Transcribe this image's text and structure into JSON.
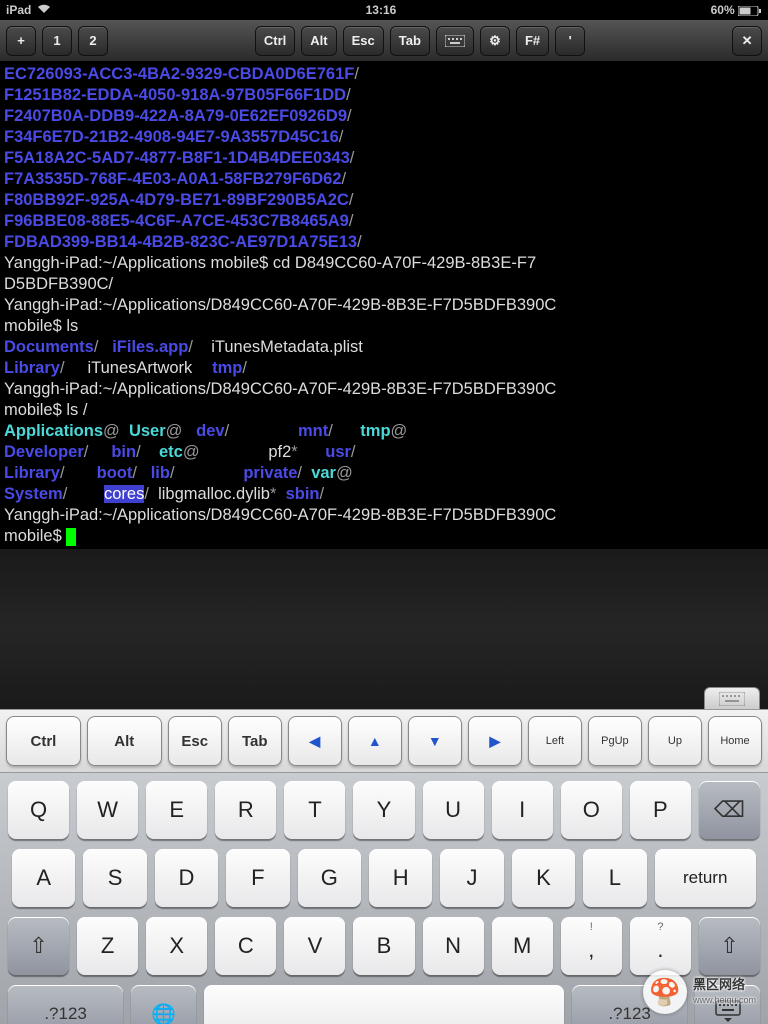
{
  "status": {
    "device": "iPad",
    "time": "13:16",
    "battery": "60%"
  },
  "toolbar": {
    "plus": "+",
    "one": "1",
    "two": "2",
    "ctrl": "Ctrl",
    "alt": "Alt",
    "esc": "Esc",
    "tab": "Tab",
    "fsharp": "F#",
    "apostrophe": "'",
    "close": "✕"
  },
  "terminal": {
    "uuids": [
      "EC726093-ACC3-4BA2-9329-CBDA0D6E761F",
      "F1251B82-EDDA-4050-918A-97B05F66F1DD",
      "F2407B0A-DDB9-422A-8A79-0E62EF0926D9",
      "F34F6E7D-21B2-4908-94E7-9A3557D45C16",
      "F5A18A2C-5AD7-4877-B8F1-1D4B4DEE0343",
      "F7A3535D-768F-4E03-A0A1-58FB279F6D62",
      "F80BB92F-925A-4D79-BE71-89BF290B5A2C",
      "F96BBE08-88E5-4C6F-A7CE-453C7B8465A9",
      "FDBAD399-BB14-4B2B-823C-AE97D1A75E13"
    ],
    "prompt1a": "Yanggh-iPad:~/Applications mobile$ cd D849CC60-A70F-429B-8B3E-F7",
    "prompt1b": "D5BDFB390C/",
    "prompt2": "Yanggh-iPad:~/Applications/D849CC60-A70F-429B-8B3E-F7D5BDFB390C",
    "prompt2b": "mobile$ ls",
    "ls1a": "Documents",
    "ls1b": "iFiles.app",
    "ls1c": "iTunesMetadata.plist",
    "ls2a": "Library",
    "ls2b": "iTunesArtwork",
    "ls2c": "tmp",
    "prompt3": "Yanggh-iPad:~/Applications/D849CC60-A70F-429B-8B3E-F7D5BDFB390C",
    "prompt3b": "mobile$ ls /",
    "root": {
      "r1c1": "Applications",
      "r1c2": "User",
      "r1c3": "dev",
      "r1c4": "mnt",
      "r1c5": "tmp",
      "r2c1": "Developer",
      "r2c2": "bin",
      "r2c3": "etc",
      "r2c4": "pf2",
      "r2c5": "usr",
      "r3c1": "Library",
      "r3c2": "boot",
      "r3c3": "lib",
      "r3c4": "private",
      "r3c5": "var",
      "r4c1": "System",
      "r4c2": "cores",
      "r4c3": "libgmalloc.dylib",
      "r4c4": "sbin"
    },
    "prompt4": "Yanggh-iPad:~/Applications/D849CC60-A70F-429B-8B3E-F7D5BDFB390C",
    "prompt4b": "mobile$ "
  },
  "fnrow": {
    "ctrl": "Ctrl",
    "alt": "Alt",
    "esc": "Esc",
    "tab": "Tab",
    "left": "Left",
    "pgup": "PgUp",
    "up": "Up",
    "home": "Home"
  },
  "keys": {
    "r1": [
      "Q",
      "W",
      "E",
      "R",
      "T",
      "Y",
      "U",
      "I",
      "O",
      "P"
    ],
    "r2": [
      "A",
      "S",
      "D",
      "F",
      "G",
      "H",
      "J",
      "K",
      "L"
    ],
    "r3": [
      "Z",
      "X",
      "C",
      "V",
      "B",
      "N",
      "M"
    ],
    "return": "return",
    "shift": "⇧",
    "backspace": "⌫",
    "numkey": ".?123",
    "globe": "🌐",
    "hidekb": "⌨",
    "punct1": "!",
    "punct1b": ",",
    "punct2": "?",
    "punct2b": "."
  },
  "watermark": {
    "main": "黑区网络",
    "sub": "www.heiqu.com"
  }
}
